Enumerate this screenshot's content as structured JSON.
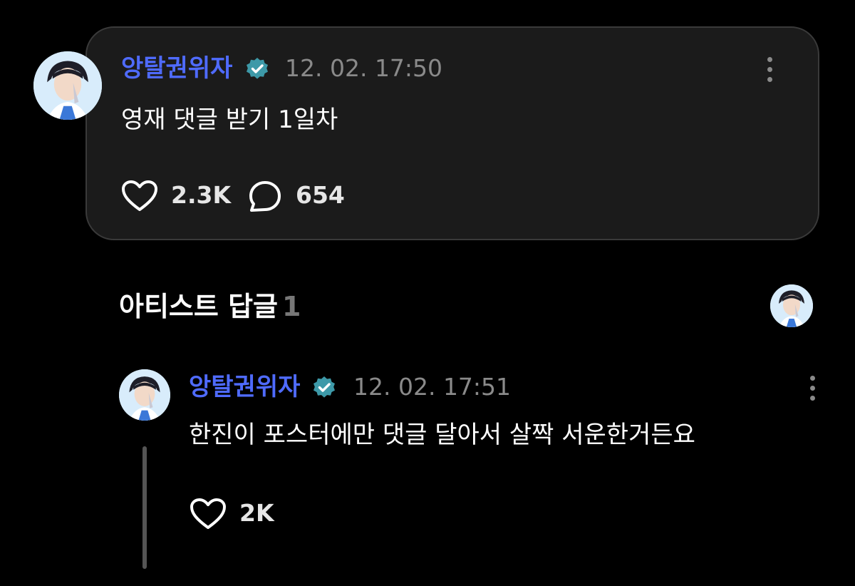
{
  "post": {
    "author": "앙탈권위자",
    "timestamp": "12. 02. 17:50",
    "text": "영재 댓글 받기 1일차",
    "likes": "2.3K",
    "comments": "654"
  },
  "section": {
    "title": "아티스트 답글",
    "count": "1"
  },
  "reply": {
    "author": "앙탈권위자",
    "timestamp": "12. 02. 17:51",
    "text": "한진이 포스터에만 댓글 달아서 살짝 서운한거든요",
    "likes": "2K"
  },
  "icons": {
    "verified": "verified-badge-icon",
    "like": "heart-icon",
    "comment": "comment-bubble-icon",
    "more": "more-vertical-icon"
  },
  "colors": {
    "background": "#000000",
    "card": "#1b1b1b",
    "accent_name": "#4f6bff",
    "verified_badge": "#3d99a8",
    "timestamp": "#8a8a8a"
  }
}
